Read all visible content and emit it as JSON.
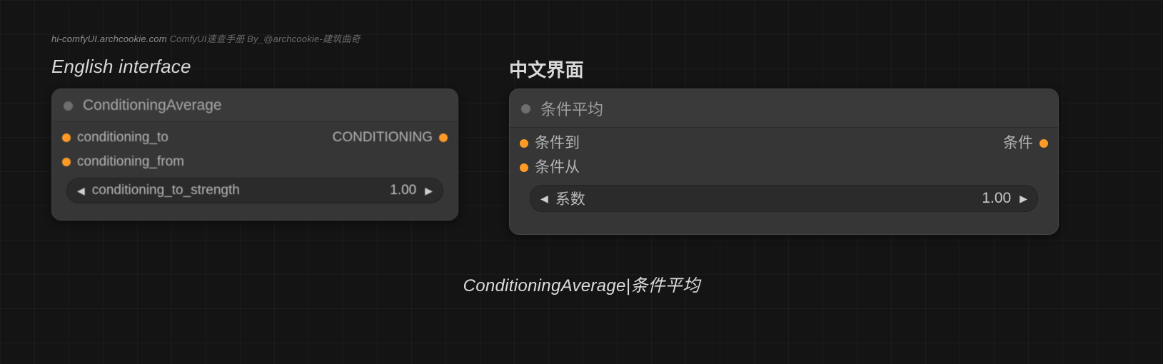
{
  "watermark": {
    "site": "hi-comfyUI.archcookie.com",
    "rest": " ComfyUI速查手册 By_@archcookie-建筑曲奇"
  },
  "labels": {
    "english": "English interface",
    "chinese": "中文界面"
  },
  "node_en": {
    "title": "ConditioningAverage",
    "inputs": [
      "conditioning_to",
      "conditioning_from"
    ],
    "outputs": [
      "CONDITIONING"
    ],
    "widget": {
      "name": "conditioning_to_strength",
      "value": "1.00"
    }
  },
  "node_zh": {
    "title": "条件平均",
    "inputs": [
      "条件到",
      "条件从"
    ],
    "outputs": [
      "条件"
    ],
    "widget": {
      "name": "系数",
      "value": "1.00"
    }
  },
  "caption": "ConditioningAverage|条件平均",
  "colors": {
    "port": "#ff9a27"
  }
}
